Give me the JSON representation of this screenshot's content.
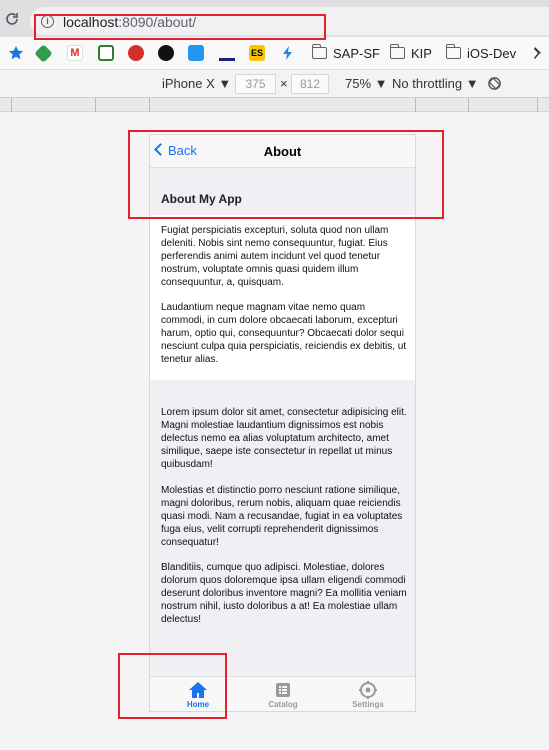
{
  "browser": {
    "url_host": "localhost",
    "url_rest": ":8090/about/",
    "bookmarks": [
      "SAP-SF",
      "KIP",
      "iOS-Dev"
    ]
  },
  "devtools": {
    "device": "iPhone X ▼",
    "width": "375",
    "times": "×",
    "height": "812",
    "zoom": "75% ▼",
    "throttling": "No throttling ▼"
  },
  "app": {
    "back_label": "Back",
    "nav_title": "About",
    "section_title": "About My App",
    "card_paragraphs": [
      "Fugiat perspiciatis excepturi, soluta quod non ullam deleniti. Nobis sint nemo consequuntur, fugiat. Eius perferendis animi autem incidunt vel quod tenetur nostrum, voluptate omnis quasi quidem illum consequuntur, a, quisquam.",
      "Laudantium neque magnam vitae nemo quam commodi, in cum dolore obcaecati laborum, excepturi harum, optio qui, consequuntur? Obcaecati dolor sequi nesciunt culpa quia perspiciatis, reiciendis ex debitis, ut tenetur alias."
    ],
    "body_paragraphs": [
      "Lorem ipsum dolor sit amet, consectetur adipisicing elit. Magni molestiae laudantium dignissimos est nobis delectus nemo ea alias voluptatum architecto, amet similique, saepe iste consectetur in repellat ut minus quibusdam!",
      "Molestias et distinctio porro nesciunt ratione similique, magni doloribus, rerum nobis, aliquam quae reiciendis quasi modi. Nam a recusandae, fugiat in ea voluptates fuga eius, velit corrupti reprehenderit dignissimos consequatur!",
      "Blanditiis, cumque quo adipisci. Molestiae, dolores dolorum quos doloremque ipsa ullam eligendi commodi deserunt doloribus inventore magni? Ea mollitia veniam nostrum nihil, iusto doloribus a at! Ea molestiae ullam delectus!"
    ],
    "tabs": [
      {
        "label": "Home",
        "icon": "home-icon",
        "active": true
      },
      {
        "label": "Catalog",
        "icon": "list-icon",
        "active": false
      },
      {
        "label": "Settings",
        "icon": "gear-icon",
        "active": false
      }
    ],
    "accent_color": "#1a73e8",
    "annotation_color": "#e5202e"
  }
}
